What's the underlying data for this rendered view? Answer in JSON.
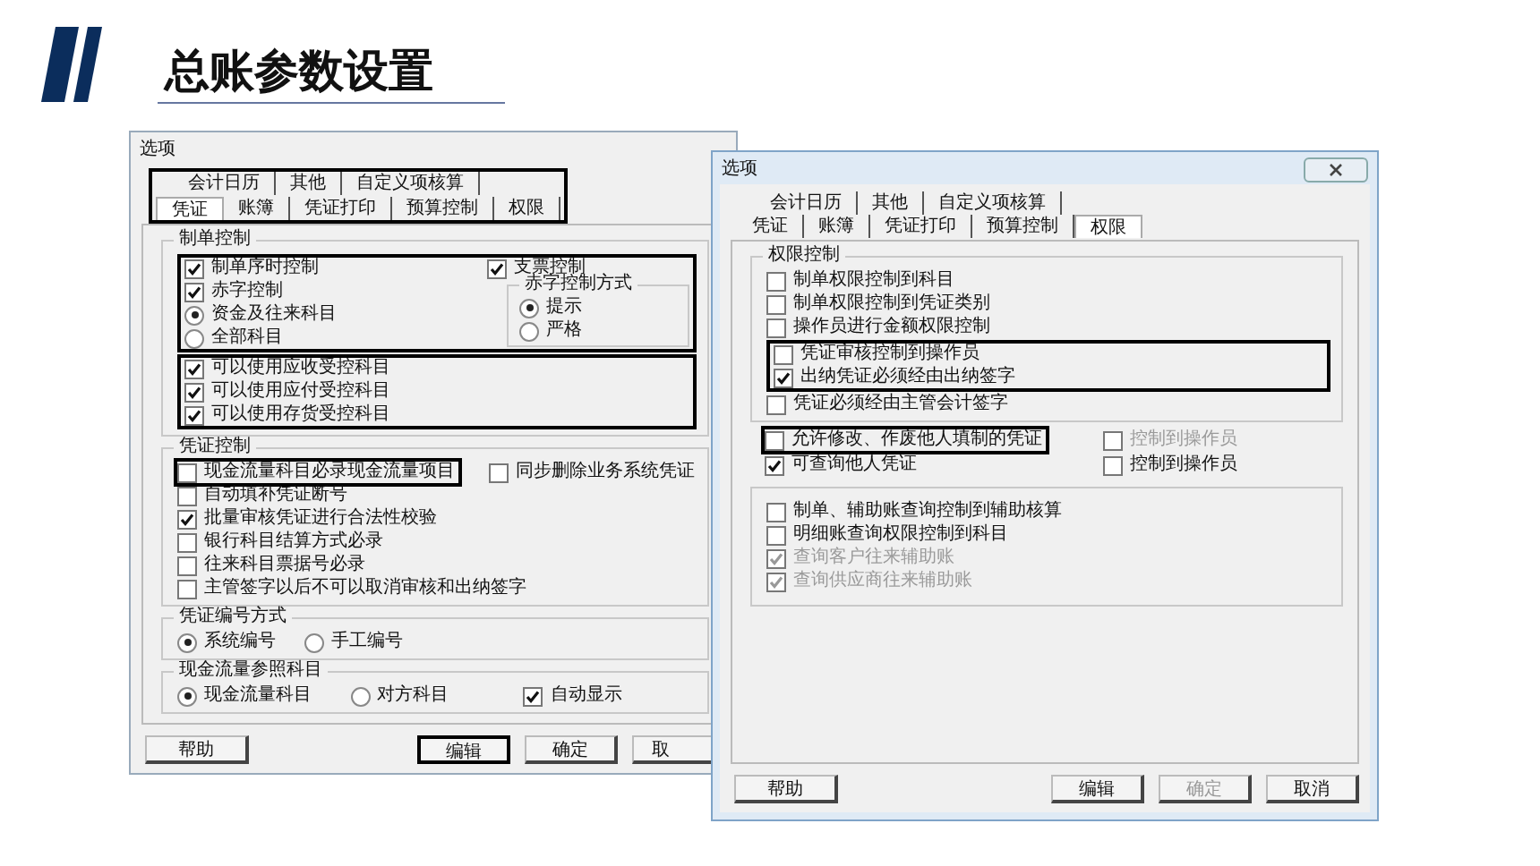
{
  "slide_title": "总账参数设置",
  "dialogs": [
    {
      "title": "选项",
      "close_button": false,
      "tabs_highlighted": true,
      "tab_rows": [
        [
          {
            "label": "会计日历",
            "selected": false
          },
          {
            "label": "其他",
            "selected": false
          },
          {
            "label": "自定义项核算",
            "selected": false
          }
        ],
        [
          {
            "label": "凭证",
            "selected": true
          },
          {
            "label": "账簿",
            "selected": false
          },
          {
            "label": "凭证打印",
            "selected": false
          },
          {
            "label": "预算控制",
            "selected": false
          },
          {
            "label": "权限",
            "selected": false
          }
        ]
      ],
      "sections": [
        {
          "kind": "group",
          "title": "制单控制",
          "entries": [
            {
              "kind": "frame",
              "entries": [
                {
                  "kind": "row",
                  "controls": [
                    {
                      "kind": "checkbox",
                      "label": "制单序时控制",
                      "checked": true
                    },
                    {
                      "kind": "checkbox",
                      "label": "支票控制",
                      "checked": true
                    }
                  ]
                },
                {
                  "kind": "split",
                  "left": [
                    {
                      "kind": "inline",
                      "controls": [
                        {
                          "kind": "checkbox",
                          "label": "赤字控制",
                          "checked": true
                        }
                      ]
                    },
                    {
                      "kind": "inline",
                      "controls": [
                        {
                          "kind": "radio",
                          "label": "资金及往来科目",
                          "selected": true
                        }
                      ]
                    },
                    {
                      "kind": "inline",
                      "controls": [
                        {
                          "kind": "radio",
                          "label": "全部科目",
                          "selected": false
                        }
                      ]
                    }
                  ],
                  "right": {
                    "kind": "group",
                    "title": "赤字控制方式",
                    "entries": [
                      {
                        "kind": "inline",
                        "controls": [
                          {
                            "kind": "radio",
                            "label": "提示",
                            "selected": true
                          }
                        ]
                      },
                      {
                        "kind": "inline",
                        "controls": [
                          {
                            "kind": "radio",
                            "label": "严格",
                            "selected": false
                          }
                        ]
                      }
                    ]
                  }
                }
              ]
            },
            {
              "kind": "frame",
              "entries": [
                {
                  "kind": "inline",
                  "controls": [
                    {
                      "kind": "checkbox",
                      "label": "可以使用应收受控科目",
                      "checked": true
                    }
                  ]
                },
                {
                  "kind": "inline",
                  "controls": [
                    {
                      "kind": "checkbox",
                      "label": "可以使用应付受控科目",
                      "checked": true
                    }
                  ]
                },
                {
                  "kind": "inline",
                  "controls": [
                    {
                      "kind": "checkbox",
                      "label": "可以使用存货受控科目",
                      "checked": true
                    }
                  ]
                }
              ]
            }
          ]
        },
        {
          "kind": "group",
          "title": "凭证控制",
          "entries": [
            {
              "kind": "row",
              "controls": [
                {
                  "kind": "checkbox",
                  "label": "现金流量科目必录现金流量项目",
                  "checked": false,
                  "highlighted": true
                },
                {
                  "kind": "checkbox",
                  "label": "同步删除业务系统凭证",
                  "checked": false
                }
              ]
            },
            {
              "kind": "inline",
              "controls": [
                {
                  "kind": "checkbox",
                  "label": "自动填补凭证断号",
                  "checked": false
                }
              ]
            },
            {
              "kind": "inline",
              "controls": [
                {
                  "kind": "checkbox",
                  "label": "批量审核凭证进行合法性校验",
                  "checked": true
                }
              ]
            },
            {
              "kind": "inline",
              "controls": [
                {
                  "kind": "checkbox",
                  "label": "银行科目结算方式必录",
                  "checked": false
                }
              ]
            },
            {
              "kind": "inline",
              "controls": [
                {
                  "kind": "checkbox",
                  "label": "往来科目票据号必录",
                  "checked": false
                }
              ]
            },
            {
              "kind": "inline",
              "controls": [
                {
                  "kind": "checkbox",
                  "label": "主管签字以后不可以取消审核和出纳签字",
                  "checked": false
                }
              ]
            }
          ]
        },
        {
          "kind": "group",
          "title": "凭证编号方式",
          "entries": [
            {
              "kind": "inline",
              "controls": [
                {
                  "kind": "radio",
                  "label": "系统编号",
                  "selected": true
                },
                {
                  "kind": "radio",
                  "label": "手工编号",
                  "selected": false
                }
              ]
            }
          ]
        },
        {
          "kind": "group",
          "title": "现金流量参照科目",
          "entries": [
            {
              "kind": "row",
              "controls": [
                {
                  "kind": "radio",
                  "label": "现金流量科目",
                  "selected": true
                },
                {
                  "kind": "radio",
                  "label": "对方科目",
                  "selected": false
                },
                {
                  "kind": "checkbox",
                  "label": "自动显示",
                  "checked": true
                }
              ]
            }
          ]
        }
      ],
      "buttons": [
        {
          "label": "帮助",
          "disabled": false,
          "highlighted": false
        },
        {
          "label": "编辑",
          "disabled": false,
          "highlighted": true
        },
        {
          "label": "确定",
          "disabled": false,
          "highlighted": false
        },
        {
          "label": "取",
          "disabled": false,
          "highlighted": false
        }
      ]
    },
    {
      "title": "选项",
      "close_button": true,
      "tabs_highlighted": false,
      "tab_rows": [
        [
          {
            "label": "会计日历",
            "selected": false
          },
          {
            "label": "其他",
            "selected": false
          },
          {
            "label": "自定义项核算",
            "selected": false
          }
        ],
        [
          {
            "label": "凭证",
            "selected": false
          },
          {
            "label": "账簿",
            "selected": false
          },
          {
            "label": "凭证打印",
            "selected": false
          },
          {
            "label": "预算控制",
            "selected": false
          },
          {
            "label": "权限",
            "selected": true
          }
        ]
      ],
      "sections": [
        {
          "kind": "group",
          "title": "权限控制",
          "entries": [
            {
              "kind": "inline",
              "controls": [
                {
                  "kind": "checkbox",
                  "label": "制单权限控制到科目",
                  "checked": false
                }
              ]
            },
            {
              "kind": "inline",
              "controls": [
                {
                  "kind": "checkbox",
                  "label": "制单权限控制到凭证类别",
                  "checked": false
                }
              ]
            },
            {
              "kind": "inline",
              "controls": [
                {
                  "kind": "checkbox",
                  "label": "操作员进行金额权限控制",
                  "checked": false
                }
              ]
            },
            {
              "kind": "frame",
              "entries": [
                {
                  "kind": "inline",
                  "controls": [
                    {
                      "kind": "checkbox",
                      "label": "凭证审核控制到操作员",
                      "checked": false
                    }
                  ]
                },
                {
                  "kind": "inline",
                  "controls": [
                    {
                      "kind": "checkbox",
                      "label": "出纳凭证必须经由出纳签字",
                      "checked": true
                    }
                  ]
                }
              ]
            },
            {
              "kind": "inline",
              "controls": [
                {
                  "kind": "checkbox",
                  "label": "凭证必须经由主管会计签字",
                  "checked": false
                }
              ]
            }
          ]
        },
        {
          "kind": "plain",
          "entries": [
            {
              "kind": "row",
              "controls": [
                {
                  "kind": "checkbox",
                  "label": "允许修改、作废他人填制的凭证",
                  "checked": false,
                  "highlighted": true,
                  "disabled": false
                },
                {
                  "kind": "checkbox",
                  "label": "控制到操作员",
                  "checked": false,
                  "disabled": true
                }
              ]
            },
            {
              "kind": "row",
              "controls": [
                {
                  "kind": "checkbox",
                  "label": "可查询他人凭证",
                  "checked": true,
                  "disabled": false
                },
                {
                  "kind": "checkbox",
                  "label": "控制到操作员",
                  "checked": false,
                  "disabled": false
                }
              ]
            }
          ]
        },
        {
          "kind": "box",
          "entries": [
            {
              "kind": "inline",
              "controls": [
                {
                  "kind": "checkbox",
                  "label": "制单、辅助账查询控制到辅助核算",
                  "checked": false,
                  "disabled": false
                }
              ]
            },
            {
              "kind": "inline",
              "controls": [
                {
                  "kind": "checkbox",
                  "label": "明细账查询权限控制到科目",
                  "checked": false,
                  "disabled": false
                }
              ]
            },
            {
              "kind": "inline",
              "controls": [
                {
                  "kind": "checkbox",
                  "label": "查询客户往来辅助账",
                  "checked": true,
                  "disabled": true
                }
              ]
            },
            {
              "kind": "inline",
              "controls": [
                {
                  "kind": "checkbox",
                  "label": "查询供应商往来辅助账",
                  "checked": true,
                  "disabled": true
                }
              ]
            }
          ]
        }
      ],
      "buttons": [
        {
          "label": "帮助",
          "disabled": false,
          "highlighted": false
        },
        {
          "label": "编辑",
          "disabled": false,
          "highlighted": false
        },
        {
          "label": "确定",
          "disabled": true,
          "highlighted": false
        },
        {
          "label": "取消",
          "disabled": false,
          "highlighted": false
        }
      ]
    }
  ]
}
